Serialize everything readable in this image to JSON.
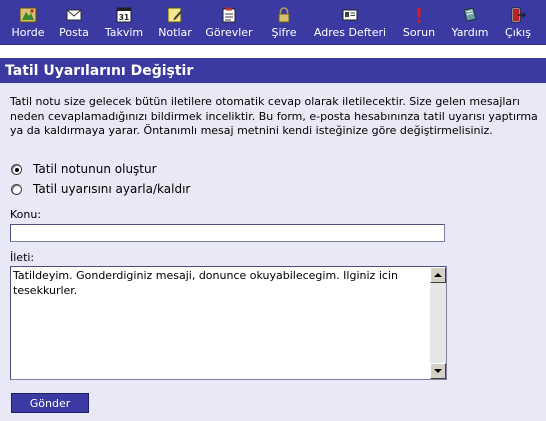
{
  "nav": {
    "items": [
      {
        "label": "Horde",
        "icon": "horde-icon"
      },
      {
        "label": "Posta",
        "icon": "mail-icon"
      },
      {
        "label": "Takvim",
        "icon": "calendar-icon"
      },
      {
        "label": "Notlar",
        "icon": "notes-icon"
      },
      {
        "label": "Görevler",
        "icon": "tasks-icon"
      },
      {
        "label": "Şifre",
        "icon": "lock-icon"
      },
      {
        "label": "Adres Defteri",
        "icon": "address-book-icon"
      },
      {
        "label": "Sorun",
        "icon": "problem-icon"
      },
      {
        "label": "Yardım",
        "icon": "help-icon"
      },
      {
        "label": "Çıkış",
        "icon": "logout-icon"
      }
    ],
    "calendar_day": "31"
  },
  "page": {
    "title": "Tatil Uyarılarını Değiştir",
    "description": "Tatil notu size gelecek bütün iletilere otomatik cevap olarak iletilecektir. Size gelen mesajları neden cevaplamadığınızı bildirmek inceliktir. Bu form, e-posta hesabınınza tatil uyarısı yaptırma ya da kaldırmaya yarar. Öntanımlı mesaj metnini kendi isteğinize göre değiştirmelisiniz."
  },
  "form": {
    "options": [
      {
        "label": "Tatil notunun oluştur",
        "checked": true
      },
      {
        "label": "Tatil uyarısını ayarla/kaldır",
        "checked": false
      }
    ],
    "subject_label": "Konu:",
    "subject_value": "",
    "message_label": "İleti:",
    "message_value": "Tatildeyim. Gonderdiginiz mesaji, donunce okuyabilecegim. Ilginiz icin tesekkurler.",
    "submit_label": "Gönder"
  },
  "colors": {
    "header_bg": "#3a3aa2",
    "content_bg": "#e8e8f6"
  }
}
